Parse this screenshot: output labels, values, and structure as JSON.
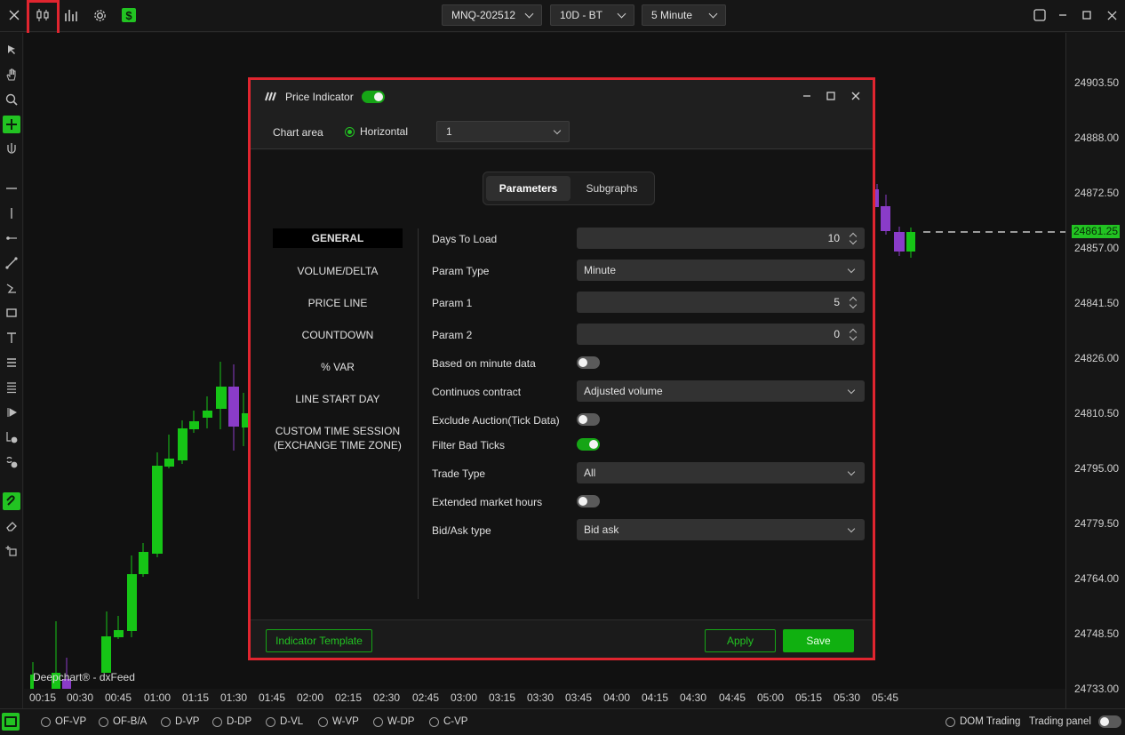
{
  "topbar": {
    "symbol": "MNQ-202512",
    "range": "10D - BT",
    "interval": "5 Minute"
  },
  "price_axis": {
    "labels": [
      "24903.50",
      "24888.00",
      "24872.50",
      "24857.00",
      "24841.50",
      "24826.00",
      "24810.50",
      "24795.00",
      "24779.50",
      "24764.00",
      "24748.50",
      "24733.00"
    ],
    "current": "24861.25"
  },
  "time_axis": {
    "labels": [
      "00:15",
      "00:30",
      "00:45",
      "01:00",
      "01:15",
      "01:30",
      "01:45",
      "02:00",
      "02:15",
      "02:30",
      "02:45",
      "03:00",
      "03:15",
      "03:30",
      "03:45",
      "04:00",
      "04:15",
      "04:30",
      "04:45",
      "05:00",
      "05:15",
      "05:30",
      "05:45"
    ]
  },
  "watermark": "Deepchart® - dxFeed",
  "dialog": {
    "title": "Price Indicator",
    "chart_area_label": "Chart area",
    "orientation": "Horizontal",
    "area_value": "1",
    "tabs": [
      "Parameters",
      "Subgraphs"
    ],
    "nav": [
      "GENERAL",
      "VOLUME/DELTA",
      "PRICE LINE",
      "COUNTDOWN",
      "% VAR",
      "LINE START DAY",
      "CUSTOM TIME SESSION\n(EXCHANGE TIME ZONE)"
    ],
    "params": {
      "days_to_load": {
        "label": "Days To Load",
        "value": "10"
      },
      "param_type": {
        "label": "Param Type",
        "value": "Minute"
      },
      "param1": {
        "label": "Param 1",
        "value": "5"
      },
      "param2": {
        "label": "Param 2",
        "value": "0"
      },
      "based_on_minute": {
        "label": "Based on minute data",
        "on": false
      },
      "continuous": {
        "label": "Continuos contract",
        "value": "Adjusted volume"
      },
      "exclude_auction": {
        "label": "Exclude Auction(Tick Data)",
        "on": false
      },
      "filter_bad": {
        "label": "Filter Bad Ticks",
        "on": true
      },
      "trade_type": {
        "label": "Trade Type",
        "value": "All"
      },
      "extended_hours": {
        "label": "Extended market hours",
        "on": false
      },
      "bidask_type": {
        "label": "Bid/Ask type",
        "value": "Bid ask"
      }
    },
    "footer": {
      "template": "Indicator Template",
      "apply": "Apply",
      "save": "Save"
    }
  },
  "bottombar": {
    "items": [
      "OF-VP",
      "OF-B/A",
      "D-VP",
      "D-DP",
      "D-VL",
      "W-VP",
      "W-DP",
      "C-VP"
    ],
    "dom_trading": "DOM Trading",
    "trading_panel": "Trading panel"
  },
  "colors": {
    "up": "#16c516",
    "down": "#8a3cc8",
    "accent": "#22c322",
    "highlight": "#e0252f"
  }
}
